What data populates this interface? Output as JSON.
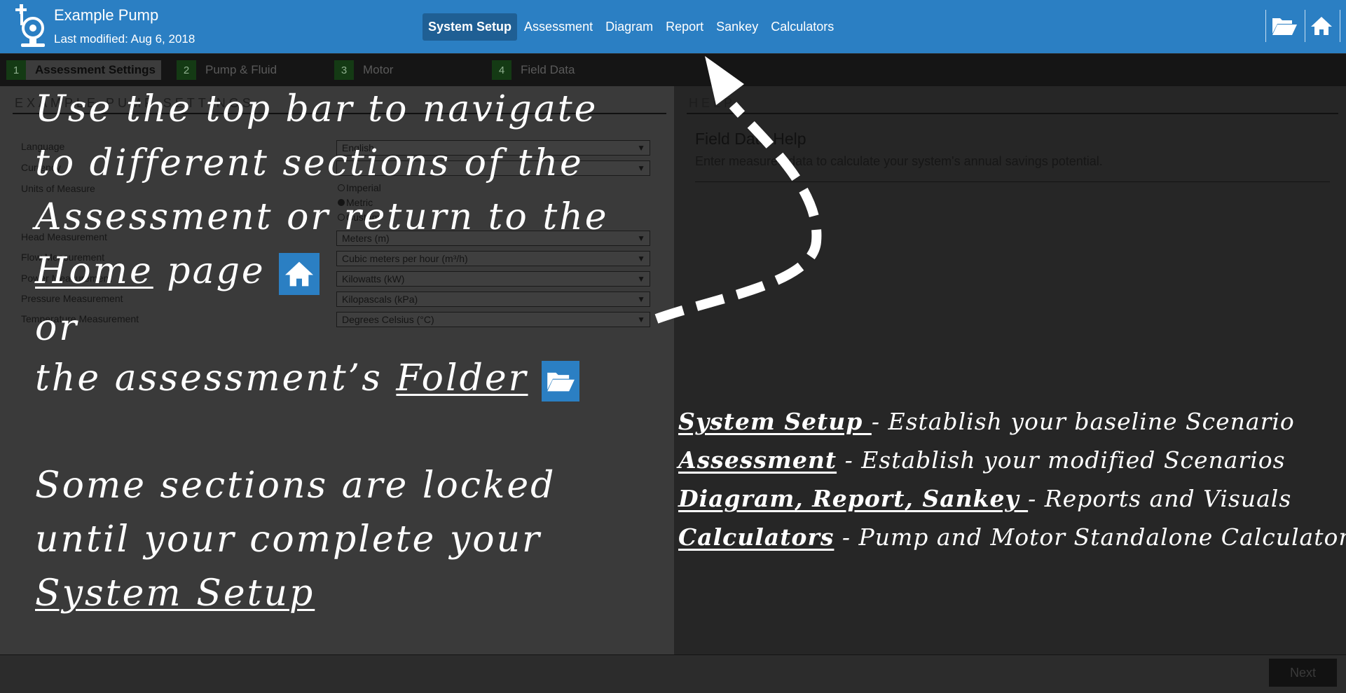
{
  "app": {
    "title": "Example Pump",
    "last_modified": "Last modified: Aug 6, 2018",
    "brand_color": "#2b7fc3",
    "logo_icon": "pump-icon"
  },
  "nav": {
    "tabs": [
      {
        "label": "System Setup",
        "active": true
      },
      {
        "label": "Assessment",
        "active": false
      },
      {
        "label": "Diagram",
        "active": false
      },
      {
        "label": "Report",
        "active": false
      },
      {
        "label": "Sankey",
        "active": false
      },
      {
        "label": "Calculators",
        "active": false
      }
    ],
    "folder_icon": "folder-open-icon",
    "home_icon": "home-icon"
  },
  "steps": [
    {
      "num": "1",
      "label": "Assessment Settings"
    },
    {
      "num": "2",
      "label": "Pump & Fluid"
    },
    {
      "num": "3",
      "label": "Motor"
    },
    {
      "num": "4",
      "label": "Field Data"
    }
  ],
  "settings": {
    "heading": "EXAMPLE PUMP SETTINGS",
    "language": {
      "label": "Language",
      "value": "English"
    },
    "currency": {
      "label": "Currency",
      "value": ""
    },
    "units": {
      "label": "Units of Measure",
      "options": [
        {
          "label": "Imperial",
          "selected": false
        },
        {
          "label": "Metric",
          "selected": true
        },
        {
          "label": "Custom",
          "selected": false
        }
      ]
    },
    "head": {
      "label": "Head Measurement",
      "value": "Meters (m)"
    },
    "flow": {
      "label": "Flow Measurement",
      "value": "Cubic meters per hour (m³/h)"
    },
    "power": {
      "label": "Power Measurement",
      "value": "Kilowatts (kW)"
    },
    "pressure": {
      "label": "Pressure Measurement",
      "value": "Kilopascals (kPa)"
    },
    "temperature": {
      "label": "Temperature Measurement",
      "value": "Degrees Celsius (°C)"
    }
  },
  "help": {
    "heading": "HELP",
    "title": "Field Data Help",
    "text": "Enter measured data to calculate your system's annual savings potential."
  },
  "footer": {
    "next_label": "Next"
  },
  "tutorial": {
    "line1": "Use the top bar to navigate",
    "line2": "to different sections of the",
    "line3": "Assessment or return to the",
    "home_word": "Home",
    "page_word": "page",
    "or_word": "or",
    "folder_prefix": "the assessment’s",
    "folder_word": "Folder",
    "locked1": "Some sections are locked",
    "locked2": "until your complete your",
    "locked3": "System Setup",
    "legend": [
      {
        "term": "System Setup ",
        "desc": "- Establish your baseline Scenario"
      },
      {
        "term": "Assessment",
        "desc": "- Establish your modified Scenarios"
      },
      {
        "term": "Diagram, Report, Sankey ",
        "desc": "- Reports and Visuals"
      },
      {
        "term": "Calculators",
        "desc": "- Pump and Motor Standalone Calculators"
      }
    ]
  }
}
